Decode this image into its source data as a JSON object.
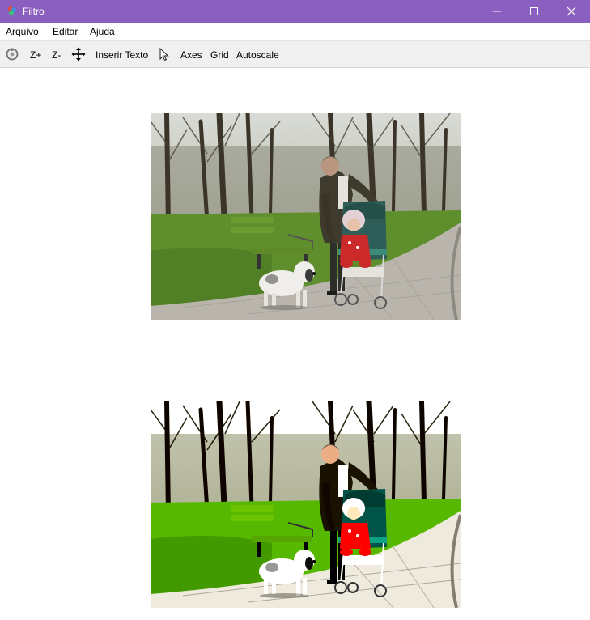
{
  "window": {
    "title": "Filtro",
    "accent_color": "#8a5fbf"
  },
  "menu": {
    "items": [
      "Arquivo",
      "Editar",
      "Ajuda"
    ]
  },
  "toolbar": {
    "zoom_in": "Z+",
    "zoom_out": "Z-",
    "insert_text": "Inserir Texto",
    "axes": "Axes",
    "grid": "Grid",
    "autoscale": "Autoscale"
  },
  "images": [
    {
      "name": "original-image",
      "content": "park scene: man with stroller, baby, dog, green bench"
    },
    {
      "name": "filtered-image",
      "content": "park scene: man with stroller, baby, dog, green bench"
    }
  ]
}
